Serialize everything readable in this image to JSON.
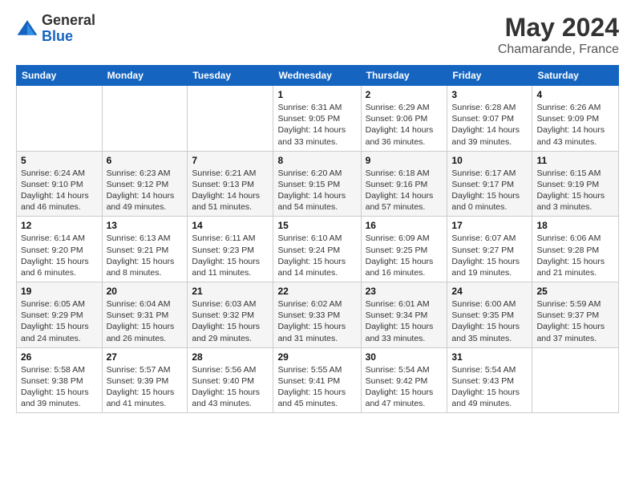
{
  "header": {
    "logo_general": "General",
    "logo_blue": "Blue",
    "month": "May 2024",
    "location": "Chamarande, France"
  },
  "days_of_week": [
    "Sunday",
    "Monday",
    "Tuesday",
    "Wednesday",
    "Thursday",
    "Friday",
    "Saturday"
  ],
  "weeks": [
    [
      {
        "day": "",
        "info": ""
      },
      {
        "day": "",
        "info": ""
      },
      {
        "day": "",
        "info": ""
      },
      {
        "day": "1",
        "info": "Sunrise: 6:31 AM\nSunset: 9:05 PM\nDaylight: 14 hours and 33 minutes."
      },
      {
        "day": "2",
        "info": "Sunrise: 6:29 AM\nSunset: 9:06 PM\nDaylight: 14 hours and 36 minutes."
      },
      {
        "day": "3",
        "info": "Sunrise: 6:28 AM\nSunset: 9:07 PM\nDaylight: 14 hours and 39 minutes."
      },
      {
        "day": "4",
        "info": "Sunrise: 6:26 AM\nSunset: 9:09 PM\nDaylight: 14 hours and 43 minutes."
      }
    ],
    [
      {
        "day": "5",
        "info": "Sunrise: 6:24 AM\nSunset: 9:10 PM\nDaylight: 14 hours and 46 minutes."
      },
      {
        "day": "6",
        "info": "Sunrise: 6:23 AM\nSunset: 9:12 PM\nDaylight: 14 hours and 49 minutes."
      },
      {
        "day": "7",
        "info": "Sunrise: 6:21 AM\nSunset: 9:13 PM\nDaylight: 14 hours and 51 minutes."
      },
      {
        "day": "8",
        "info": "Sunrise: 6:20 AM\nSunset: 9:15 PM\nDaylight: 14 hours and 54 minutes."
      },
      {
        "day": "9",
        "info": "Sunrise: 6:18 AM\nSunset: 9:16 PM\nDaylight: 14 hours and 57 minutes."
      },
      {
        "day": "10",
        "info": "Sunrise: 6:17 AM\nSunset: 9:17 PM\nDaylight: 15 hours and 0 minutes."
      },
      {
        "day": "11",
        "info": "Sunrise: 6:15 AM\nSunset: 9:19 PM\nDaylight: 15 hours and 3 minutes."
      }
    ],
    [
      {
        "day": "12",
        "info": "Sunrise: 6:14 AM\nSunset: 9:20 PM\nDaylight: 15 hours and 6 minutes."
      },
      {
        "day": "13",
        "info": "Sunrise: 6:13 AM\nSunset: 9:21 PM\nDaylight: 15 hours and 8 minutes."
      },
      {
        "day": "14",
        "info": "Sunrise: 6:11 AM\nSunset: 9:23 PM\nDaylight: 15 hours and 11 minutes."
      },
      {
        "day": "15",
        "info": "Sunrise: 6:10 AM\nSunset: 9:24 PM\nDaylight: 15 hours and 14 minutes."
      },
      {
        "day": "16",
        "info": "Sunrise: 6:09 AM\nSunset: 9:25 PM\nDaylight: 15 hours and 16 minutes."
      },
      {
        "day": "17",
        "info": "Sunrise: 6:07 AM\nSunset: 9:27 PM\nDaylight: 15 hours and 19 minutes."
      },
      {
        "day": "18",
        "info": "Sunrise: 6:06 AM\nSunset: 9:28 PM\nDaylight: 15 hours and 21 minutes."
      }
    ],
    [
      {
        "day": "19",
        "info": "Sunrise: 6:05 AM\nSunset: 9:29 PM\nDaylight: 15 hours and 24 minutes."
      },
      {
        "day": "20",
        "info": "Sunrise: 6:04 AM\nSunset: 9:31 PM\nDaylight: 15 hours and 26 minutes."
      },
      {
        "day": "21",
        "info": "Sunrise: 6:03 AM\nSunset: 9:32 PM\nDaylight: 15 hours and 29 minutes."
      },
      {
        "day": "22",
        "info": "Sunrise: 6:02 AM\nSunset: 9:33 PM\nDaylight: 15 hours and 31 minutes."
      },
      {
        "day": "23",
        "info": "Sunrise: 6:01 AM\nSunset: 9:34 PM\nDaylight: 15 hours and 33 minutes."
      },
      {
        "day": "24",
        "info": "Sunrise: 6:00 AM\nSunset: 9:35 PM\nDaylight: 15 hours and 35 minutes."
      },
      {
        "day": "25",
        "info": "Sunrise: 5:59 AM\nSunset: 9:37 PM\nDaylight: 15 hours and 37 minutes."
      }
    ],
    [
      {
        "day": "26",
        "info": "Sunrise: 5:58 AM\nSunset: 9:38 PM\nDaylight: 15 hours and 39 minutes."
      },
      {
        "day": "27",
        "info": "Sunrise: 5:57 AM\nSunset: 9:39 PM\nDaylight: 15 hours and 41 minutes."
      },
      {
        "day": "28",
        "info": "Sunrise: 5:56 AM\nSunset: 9:40 PM\nDaylight: 15 hours and 43 minutes."
      },
      {
        "day": "29",
        "info": "Sunrise: 5:55 AM\nSunset: 9:41 PM\nDaylight: 15 hours and 45 minutes."
      },
      {
        "day": "30",
        "info": "Sunrise: 5:54 AM\nSunset: 9:42 PM\nDaylight: 15 hours and 47 minutes."
      },
      {
        "day": "31",
        "info": "Sunrise: 5:54 AM\nSunset: 9:43 PM\nDaylight: 15 hours and 49 minutes."
      },
      {
        "day": "",
        "info": ""
      }
    ]
  ]
}
